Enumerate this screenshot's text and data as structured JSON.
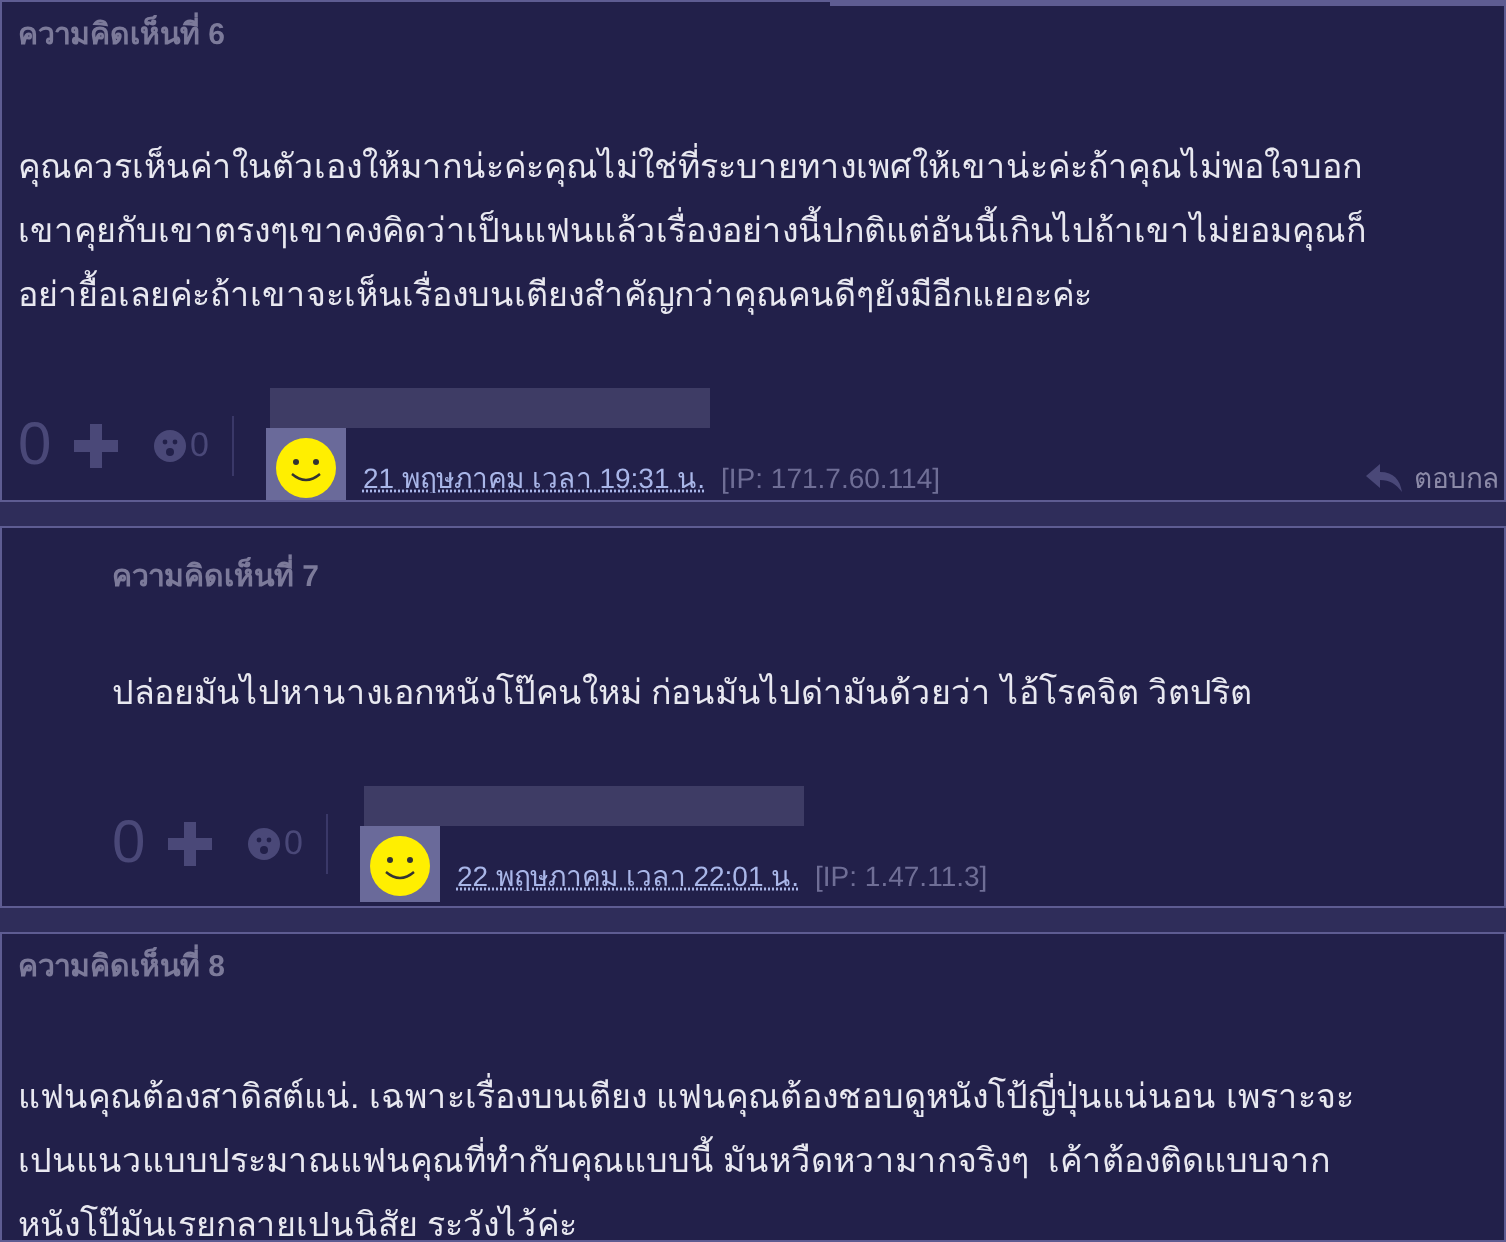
{
  "comments": [
    {
      "kind": "comment",
      "label": "ความคิดเห็นที่ 6",
      "body": [
        "คุณควรเห็นค่าในตัวเองให้มากน่ะค่ะคุณไม่ใช่ที่ระบายทางเพศให้เขาน่ะค่ะถ้าคุณไม่พอใจบอก",
        "เขาคุยกับเขาตรงๆเขาคงคิดว่าเป็นแฟนแล้วเรื่องอย่างนี้ปกติแต่อันนี้เกินไปถ้าเขาไม่ยอมคุณก็",
        "อย่ายื้อเลยค่ะถ้าเขาจะเห็นเรื่องบนเตียงสำคัญกว่าคุณคนดีๆยังมีอีกแยอะค่ะ"
      ],
      "footer": {
        "votes": "0",
        "reactions": "0",
        "date": "21 พฤษภาคม เวลา 19:31 น.",
        "ip": "[IP: 171.7.60.114]",
        "reply": "ตอบกล"
      }
    },
    {
      "kind": "reply",
      "label": "ความคิดเห็นที่ 7",
      "body": [
        "ปล่อยมันไปหานางเอกหนังโป๊คนใหม่ ก่อนมันไปด่ามันด้วยว่า ไอ้โรคจิต วิตปริต"
      ],
      "footer": {
        "votes": "0",
        "reactions": "0",
        "date": "22 พฤษภาคม เวลา 22:01 น.",
        "ip": "[IP: 1.47.11.3]"
      }
    },
    {
      "kind": "comment",
      "label": "ความคิดเห็นที่ 8",
      "body": [
        "แฟนคุณต้องสาดิสต์แน่. เฉพาะเรื่องบนเตียง แฟนคุณต้องชอบดูหนังโป้ญี่ปุ่นแน่นอน เพราะจะ",
        "เปนแนวแบบประมาณแฟนคุณที่ทำกับคุณแบบนี้ มันหวืดหวามากจริงๆ  เค้าต้องติดแบบจาก",
        "หนังโป๊มันเรยกลายเปนนิสัย ระวังไว้ค่ะ"
      ]
    }
  ]
}
